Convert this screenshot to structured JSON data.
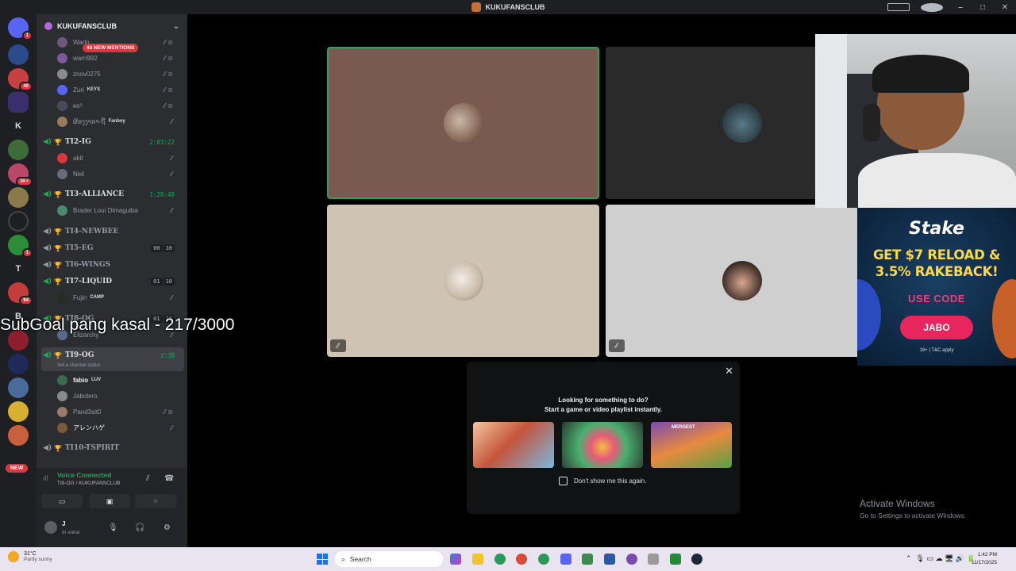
{
  "window": {
    "title": "KUKUFANSCLUB"
  },
  "servers": {
    "badges": [
      "1",
      "48",
      "1K+",
      "1",
      "94"
    ],
    "letters": [
      "K",
      "T",
      "B"
    ],
    "new_label": "NEW"
  },
  "guild": {
    "name": "KUKUFANSCLUB",
    "mentions_pill": "48 NEW MENTIONS",
    "top_members": [
      {
        "name": "Warlo",
        "tag": ""
      },
      {
        "name": "warri992",
        "tag": ""
      },
      {
        "name": "znov0275",
        "tag": ""
      },
      {
        "name": "Zuri",
        "tag": "KEYS"
      },
      {
        "name": "ĸɢ³",
        "tag": ""
      },
      {
        "name": "ຜ້ອງງາກາ-ຖື",
        "tag": "Fanboy"
      }
    ]
  },
  "voice_channels": [
    {
      "name": "TI2-IG",
      "timer": "2:03:22",
      "members": [
        "akit",
        "Neil"
      ]
    },
    {
      "name": "TI3-ALLIANCE",
      "timer": "1:28:48",
      "members": [
        "Brader Loui Dimaguiba"
      ]
    },
    {
      "name": "TI4-NEWBEE"
    },
    {
      "name": "TI5-EG",
      "count_a": "00",
      "count_b": "10"
    },
    {
      "name": "TI6-WINGS"
    },
    {
      "name": "TI7-LIQUID",
      "count_a": "01",
      "count_b": "10",
      "members": [
        {
          "name": "Fujin",
          "tag": "CAMP"
        }
      ]
    },
    {
      "name": "TI8-OG",
      "count_a": "01",
      "count_b": "10",
      "members": [
        "Elizarchy"
      ]
    },
    {
      "name": "TI9-OG",
      "timer": "2:38",
      "status": "Set a channel status",
      "members": [
        {
          "name": "fabio",
          "tag": "LUV"
        },
        "Jabolero",
        "Pand3sit0",
        "アレンハゲ"
      ]
    },
    {
      "name": "TI10-TSPIRIT"
    }
  ],
  "voice_panel": {
    "title": "Voice Connected",
    "subtitle": "TI9-OG / KUKUFANSCLUB",
    "user_name": "J",
    "user_status": "In voice"
  },
  "overlay_text": "SubGoal pang kasal - 217/3000",
  "activity": {
    "line1": "Looking for something to do?",
    "line2": "Start a game or video playlist instantly.",
    "checkbox_label": "Don't show me this again.",
    "game3_badge": "MERGEST"
  },
  "ad": {
    "brand": "Stake",
    "line1": "GET $7 RELOAD &",
    "line2": "3.5% RAKEBACK!",
    "use_code": "USE CODE",
    "code": "JABO",
    "terms": "18+ | T&C apply"
  },
  "watermark": {
    "line1": "Activate Windows",
    "line2": "Go to Settings to activate Windows."
  },
  "taskbar": {
    "weather_temp": "31°C",
    "weather_desc": "Partly sunny",
    "search_placeholder": "Search",
    "time": "1:42 PM",
    "date": "11/17/2025"
  }
}
